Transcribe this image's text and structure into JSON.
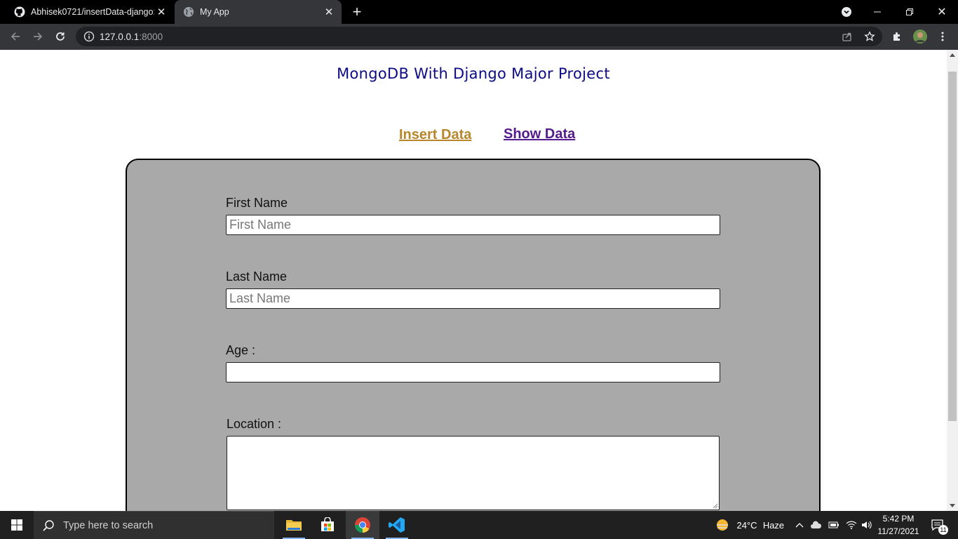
{
  "browser": {
    "tabs": [
      {
        "title": "Abhisek0721/insertData-django:",
        "icon": "github-icon"
      },
      {
        "title": "My App",
        "icon": "globe-icon"
      }
    ],
    "url_host": "127.0.0.1",
    "url_port": ":8000"
  },
  "page": {
    "title": "MongoDB With Django Major Project",
    "nav": {
      "insert": "Insert Data",
      "show": "Show Data"
    },
    "form": {
      "first_name_label": "First Name",
      "first_name_placeholder": "First Name",
      "last_name_label": "Last Name",
      "last_name_placeholder": "Last Name",
      "age_label": "Age :",
      "location_label": "Location :"
    }
  },
  "taskbar": {
    "search_placeholder": "Type here to search",
    "weather_temp": "24°C",
    "weather_desc": "Haze",
    "time": "5:42 PM",
    "date": "11/27/2021",
    "notification_count": "11"
  },
  "colors": {
    "title": "#0b0b85",
    "nav_insert": "#b8862b",
    "nav_show": "#551a8b",
    "form_bg": "#a9a9a9"
  }
}
